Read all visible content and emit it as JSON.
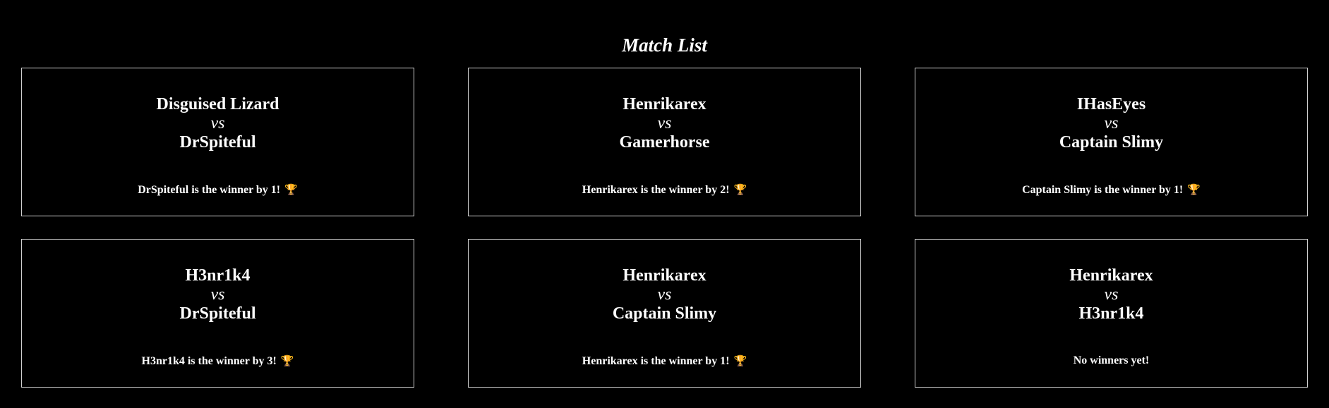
{
  "page": {
    "title": "Match List"
  },
  "matches": [
    {
      "player1": "Disguised Lizard",
      "vs": "vs",
      "player2": "DrSpiteful",
      "result": "DrSpiteful is the winner by 1!",
      "icon": "trophy-icon",
      "icon_glyph": "🏆"
    },
    {
      "player1": "Henrikarex",
      "vs": "vs",
      "player2": "Gamerhorse",
      "result": "Henrikarex is the winner by 2!",
      "icon": "trophy-icon",
      "icon_glyph": "🏆"
    },
    {
      "player1": "IHasEyes",
      "vs": "vs",
      "player2": "Captain Slimy",
      "result": "Captain Slimy is the winner by 1!",
      "icon": "trophy-icon",
      "icon_glyph": "🏆"
    },
    {
      "player1": "H3nr1k4",
      "vs": "vs",
      "player2": "DrSpiteful",
      "result": "H3nr1k4 is the winner by 3!",
      "icon": "trophy-icon",
      "icon_glyph": "🏆"
    },
    {
      "player1": "Henrikarex",
      "vs": "vs",
      "player2": "Captain Slimy",
      "result": "Henrikarex is the winner by 1!",
      "icon": "trophy-icon",
      "icon_glyph": "🏆"
    },
    {
      "player1": "Henrikarex",
      "vs": "vs",
      "player2": "H3nr1k4",
      "result": "No winners yet!",
      "icon": "",
      "icon_glyph": ""
    }
  ],
  "colors": {
    "background": "#000000",
    "text": "#ffffff",
    "card_border": "#d0d0d0",
    "trophy": "#e0a030"
  }
}
